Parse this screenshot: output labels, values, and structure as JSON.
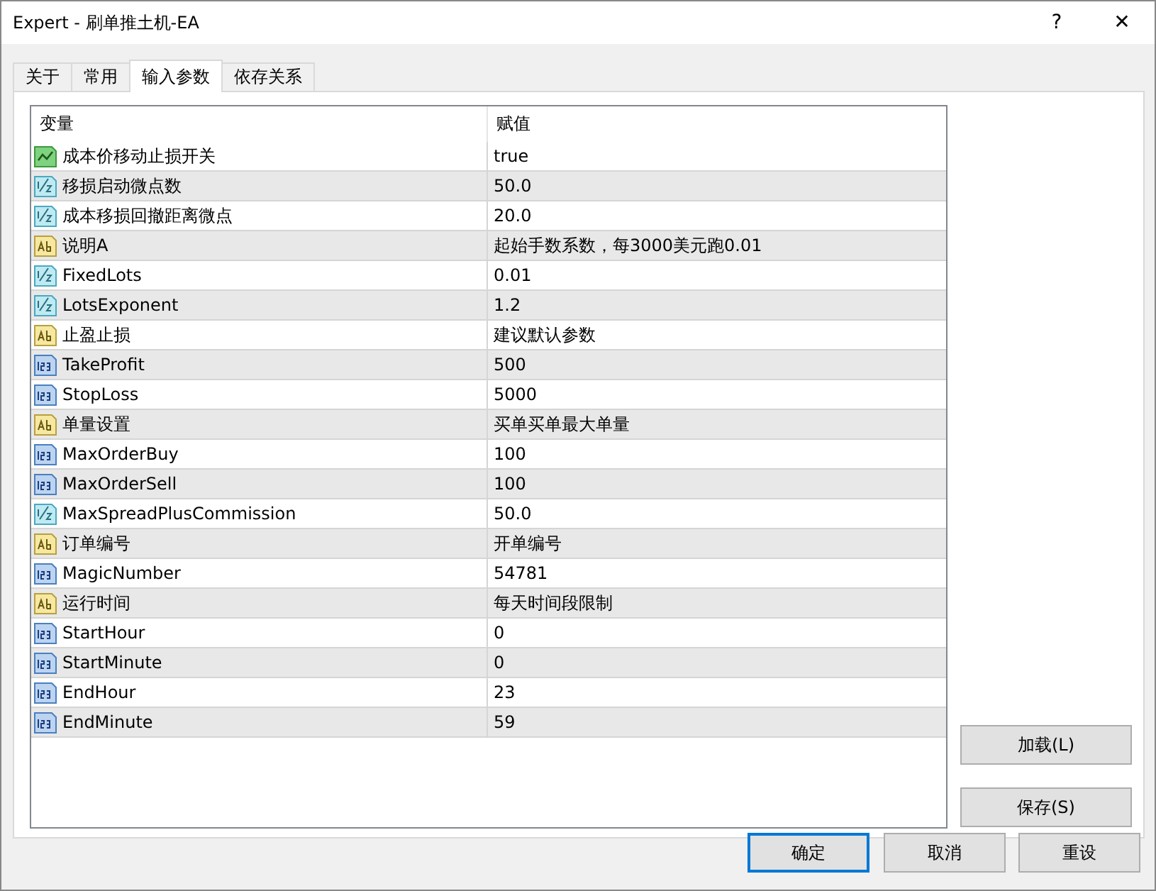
{
  "window": {
    "title": "Expert - 刷单推土机-EA",
    "help": "?",
    "close": "✕"
  },
  "tabs": [
    {
      "label": "关于",
      "selected": false
    },
    {
      "label": "常用",
      "selected": false
    },
    {
      "label": "输入参数",
      "selected": true
    },
    {
      "label": "依存关系",
      "selected": false
    }
  ],
  "table": {
    "columns": [
      "变量",
      "赋值"
    ],
    "rows": [
      {
        "kind": "bool",
        "name": "成本价移动止损开关",
        "value": "true"
      },
      {
        "kind": "double",
        "name": "移损启动微点数",
        "value": "50.0"
      },
      {
        "kind": "double",
        "name": "成本移损回撤距离微点",
        "value": "20.0"
      },
      {
        "kind": "string",
        "name": "说明A",
        "value": "起始手数系数，每3000美元跑0.01"
      },
      {
        "kind": "double",
        "name": "FixedLots",
        "value": "0.01"
      },
      {
        "kind": "double",
        "name": "LotsExponent",
        "value": "1.2"
      },
      {
        "kind": "string",
        "name": "止盈止损",
        "value": "建议默认参数"
      },
      {
        "kind": "int",
        "name": "TakeProfit",
        "value": "500"
      },
      {
        "kind": "int",
        "name": "StopLoss",
        "value": "5000"
      },
      {
        "kind": "string",
        "name": "单量设置",
        "value": "买单买单最大单量"
      },
      {
        "kind": "int",
        "name": "MaxOrderBuy",
        "value": "100"
      },
      {
        "kind": "int",
        "name": "MaxOrderSell",
        "value": "100"
      },
      {
        "kind": "double",
        "name": "MaxSpreadPlusCommission",
        "value": "50.0"
      },
      {
        "kind": "string",
        "name": "订单编号",
        "value": "开单编号"
      },
      {
        "kind": "int",
        "name": "MagicNumber",
        "value": "54781"
      },
      {
        "kind": "string",
        "name": "运行时间",
        "value": "每天时间段限制"
      },
      {
        "kind": "int",
        "name": "StartHour",
        "value": "0"
      },
      {
        "kind": "int",
        "name": "StartMinute",
        "value": "0"
      },
      {
        "kind": "int",
        "name": "EndHour",
        "value": "23"
      },
      {
        "kind": "int",
        "name": "EndMinute",
        "value": "59"
      }
    ]
  },
  "side_buttons": [
    "加载(L)",
    "保存(S)"
  ],
  "buttons": [
    {
      "label": "确定",
      "selected": true
    },
    {
      "label": "取消",
      "selected": false
    },
    {
      "label": "重设",
      "selected": false
    }
  ]
}
